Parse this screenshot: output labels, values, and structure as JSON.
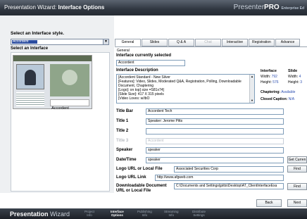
{
  "window": {
    "title_prefix": "Presentation Wizard:",
    "title_bold": "Interface Options",
    "logo_light": "Presenter",
    "logo_bold": "PRO",
    "logo_edition": "Enterprise Ed"
  },
  "left": {
    "style_heading": "Select an Interface style.",
    "style_value": "Accordent",
    "interface_heading": "Select an Interface",
    "thumbnail_label": "Accordent"
  },
  "tabs": [
    {
      "label": "General"
    },
    {
      "label": "Slides"
    },
    {
      "label": "Q & A"
    },
    {
      "label": "Chat"
    },
    {
      "label": "Interactive"
    },
    {
      "label": "Registration"
    },
    {
      "label": "Advance"
    }
  ],
  "panel": {
    "section_label": "General",
    "current_heading": "Interface currently selected",
    "current_value": "Accordent",
    "description_heading": "Interface Description",
    "description_lines": [
      "[Accordent Standard - New Silver",
      "[Features]: Video, Slides, Moderated Q&A, Registration, Polling, Downloadable",
      "Document, Chaptering",
      "[Logo]: on top] size =S81x74]",
      "[Slide Size]: 417 X 315 pixels",
      "[Video Loves: w/ibO"
    ],
    "interface_heading": "Interface",
    "slide_heading": "Slide",
    "width_label": "Width:",
    "width_value": "792",
    "height_label": "Height:",
    "height_value": "576",
    "slide_width_label": "Width:",
    "slide_width_value": "4",
    "slide_height_label": "Height:",
    "slide_height_value": "3",
    "chaptering_label": "Chaptering:",
    "chaptering_value": "Available",
    "captions_label": "Closed Caption:",
    "captions_value": "N/A"
  },
  "fields": {
    "title_bar_label": "Title Bar",
    "title_bar_value": "Accordent Tech",
    "title1_label": "Title 1",
    "title1_value": "Speaker: Jerome Pitts",
    "title2_label": "Title 2",
    "title2_value": "",
    "title3_label": "Title 3",
    "title3_value": "Accordent",
    "speaker_label": "Speaker",
    "speaker_value": "speaker",
    "datetime_label": "Date/Time",
    "datetime_value": "speaker",
    "logo_label": "Logo URL or Local File",
    "logo_value": "Associated Securities Corp",
    "logo_link_label": "Logo URL Link",
    "logo_link_value": "http://www.afgweb.com",
    "doc_label_1": "Downloadable Document",
    "doc_label_2": "URL or Local File",
    "doc_value": "C:\\Documents and Settings\\jpitts\\Desktop\\AT_ClientInterfaceExa"
  },
  "buttons": {
    "get_current": "Get Curren",
    "find1": "Find",
    "find2": "Find",
    "back": "Back",
    "next": "Next"
  },
  "bottom": {
    "brand_bold": "Presentation",
    "brand_light": "Wizard",
    "steps": [
      {
        "line1": "Project",
        "line2": "Info"
      },
      {
        "line1": "Interface",
        "line2": "Options"
      },
      {
        "line1": "Publishing",
        "line2": "Info"
      },
      {
        "line1": "Streaming",
        "line2": "Info"
      },
      {
        "line1": "Distribute",
        "line2": "Settings"
      }
    ]
  }
}
